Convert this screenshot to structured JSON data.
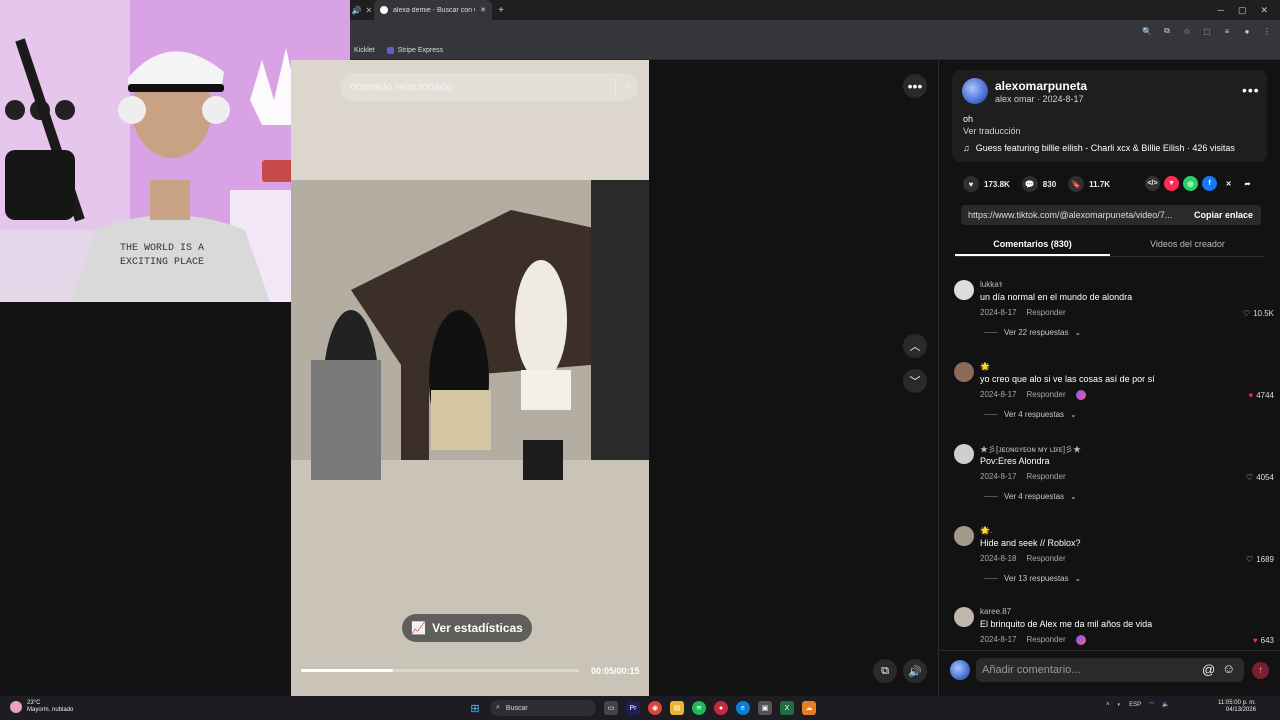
{
  "browser": {
    "tab_title": "alexa demie - Buscar con Google",
    "bookmarks": [
      "Kicklet",
      "Stripe Express"
    ]
  },
  "video": {
    "search_placeholder": "ontenido relacionado",
    "stats_button": "Ver estadísticas",
    "time": "00:05/00:15",
    "progress_fraction": 0.33
  },
  "post": {
    "username": "alexomarpuneta",
    "display_and_date": "alex omar · 2024-8-17",
    "caption": "oh",
    "translate": "Ver traducción",
    "music": "Guess featuring billie eilish - Charli xcx & Billie Eilish · 426 visitas",
    "likes": "173.8K",
    "comments": "830",
    "saves": "11.7K",
    "link": "https://www.tiktok.com/@alexomarpuneta/video/7...",
    "copy_link": "Copiar enlace",
    "tab_comments": "Comentarios (830)",
    "tab_videos": "Videos del creador"
  },
  "comments": [
    {
      "user": "lukka⚕",
      "text": "un día normal en el mundo de alondra",
      "date": "2024-8-17",
      "reply": "Responder",
      "likes": "10.5K",
      "liked": false,
      "replies": "Ver 22 respuestas"
    },
    {
      "user": "🌟",
      "text": "yo creo que alo si ve las cosas así de por sí",
      "date": "2024-8-17",
      "reply": "Responder",
      "likes": "4744",
      "liked": true,
      "replies": "Ver 4 respuestas"
    },
    {
      "user": "★彡[ᴊᴇᴏɴɢʏᴇᴏɴ ᴍʏ ʟɪғᴇ]彡★",
      "text": "Pov:Eres Alondra",
      "date": "2024-8-17",
      "reply": "Responder",
      "likes": "4054",
      "liked": false,
      "replies": "Ver 4 respuestas"
    },
    {
      "user": "🌟.",
      "text": "Hide and seek // Roblox?",
      "date": "2024-8-18",
      "reply": "Responder",
      "likes": "1689",
      "liked": false,
      "replies": "Ver 13 respuestas"
    },
    {
      "user": "karee.87",
      "text": "El brinquito de Alex me da mil años de vida",
      "date": "2024-8-17",
      "reply": "Responder",
      "likes": "643",
      "liked": true,
      "replies": ""
    }
  ],
  "comment_input": {
    "placeholder": "Añadir comentario..."
  },
  "taskbar": {
    "temp": "23°C",
    "weather": "Mayorm. nublado",
    "search": "Buscar",
    "lang": "ESP",
    "time": "11:05:00 p. m.",
    "date": "04/13/2026"
  },
  "colors": {
    "accent": "#fe2c55",
    "panel_bg": "#121212"
  }
}
